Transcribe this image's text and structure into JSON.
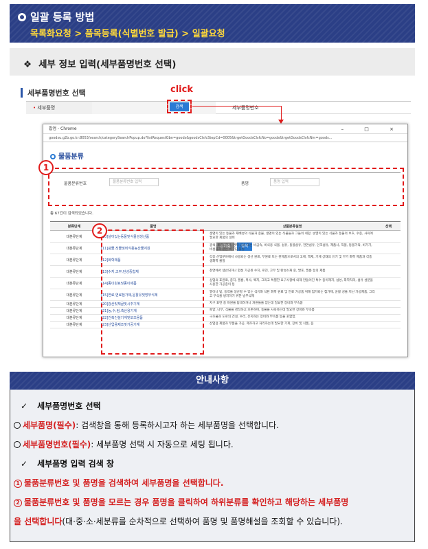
{
  "header": {
    "title": "일괄 등록 방법",
    "subtitle": "목록화요청 > 품목등록(식별번호 발급) > 일괄요청"
  },
  "section": {
    "title": "세부 정보 입력(세부품명번호 선택)"
  },
  "screenshot": {
    "title": "세부품명번호 선택",
    "click_label": "click",
    "row_label": "세부품명",
    "search_btn": "검색",
    "row_label2": "세부품명번호"
  },
  "popup": {
    "window_title": "팝업 - Chrome",
    "window_controls": "– □ ×",
    "url": "goodsu.g2b.go.kr:8053/search/categorySearchPopup.do?listRequestGbn=goods&goodsClsfcStepCd=0005&trgetGoodsClsfcNo=goods&trgetGoodsClsfcNm=goods...",
    "heading": "물품분류",
    "marker1": "1",
    "marker2": "2",
    "field1_label": "물품분류번호",
    "field1_placeholder": "물품분류번호 입력",
    "field2_label": "품명",
    "field2_placeholder": "품명 입력",
    "reset_btn": "초기화",
    "search_btn": "검색",
    "total": "총 67건이 검색되었습니다.",
    "columns": [
      "분류단계",
      "품명",
      "상품분류설명",
      "선택"
    ],
    "rows": [
      {
        "stage": "대분류단계",
        "name": "[10]살아있는동물및식물성생산품",
        "desc": "생명이 있는 동물과 재배성의 식물과 종물, 생명이 있는 식물들과 그들의 세망, 씻멸이 있는 식물과 동물의 보호, 수종, 사육에 필요한 제품의 설비"
      },
      {
        "stage": "대분류단계",
        "name": "[11]광물,직물및비식용농산물지원",
        "desc": "광석, 토양, 광석, 경제 금속 또는 비금속, 비식용 식물, 섬유, 동물섬유, 천연섬유, 인조섬유, 제품사, 직물, 동물가죽, 비가기, 비섬물과 같은 비 가공물질"
      },
      {
        "stage": "대분류단계",
        "name": "[12]화학제품",
        "desc": "각종 산업분야에서 사용되는 생산 원료, 부원료 또는 완제품으로서의 고체, 액체, 기체 상태의 유기 및 무기 화학 제품과 각종 생화학 물질"
      },
      {
        "stage": "대분류단계",
        "name": "[13]수지,고무,탄성중합체",
        "desc": "천연에서 생산되거나 합성 가공된 수지, 로진, 고무 및 탄성소재 중, 발포, 필름 등의 제품"
      },
      {
        "stage": "대분류단계",
        "name": "[14]종이원료및종이제품",
        "desc": "상업의 표원료, 종지, 필름, 목사, 백지, 그리고 특별한 요구사항에 의해 만들어진 특수 종이제지, 섬성, 화학처리, 섬유 성분을 사용한 가공종이 등"
      },
      {
        "stage": "대분류단계",
        "name": "[15]연료,연료첨가제,윤활유및방부식제",
        "desc": "열이나 빛, 동력을 생산할 수 있는 석유와 석탄 화학 원료 및 연료 가공품 위해 첨가되는 첨가제, 윤활 성을 지닌 가공제품, 그리고 부식을 방지하기 위한 방부식제"
      },
      {
        "stage": "대분류단계",
        "name": "[20]광산및채굴및시추기계",
        "desc": "지구 표면 중 자원을 탐색하거나 자원들을 얻는데 필요한 장비와 부속품"
      },
      {
        "stage": "대분류단계",
        "name": "[21]농,수,림,축산용기계",
        "desc": "토양, 나무, 식물을 경작하고 보존하며, 동물을 사육하는데 필요한 장비와 부속품"
      },
      {
        "stage": "대분류단계",
        "name": "[22]건축건설기계및보조용품",
        "desc": "구조물과 도로의 건설, 수리, 유지하는 장비와 부속품 등을 포함함."
      },
      {
        "stage": "대분류단계",
        "name": "[23]산업용제조및가공기계",
        "desc": "산업용 제품과 부품을 가공, 제조하고 처리하는데 필요한 기계, 장비 및 식품, 음"
      }
    ]
  },
  "guide": {
    "title": "안내사항",
    "h1": "세부품명번호 선택",
    "l1_bold": "세부품명(필수)",
    "l1_text": ": 검색창을 통해 등록하시고자 하는 세부품명을 선택합니다.",
    "l2_bold": "세부품명번호(필수)",
    "l2_text": ":  세부품명 선택 시 자동으로 세팅 됩니다.",
    "h2": "세부품명 입력 검색 창",
    "s1": "물품분류번호 및 품명을 검색하여 세부품명을 선택합니다.",
    "s2a": "물품분류번호 및 품명을 모르는 경우 품명을 클릭하여 하위분류를 확인하고 해당하는 세부품명",
    "s2b_red": "을 선택합니다",
    "s2b_text": "(대·중·소·세분류를 순차적으로 선택하여 품명 및 품명해설을 조회할 수 있습니다).",
    "check": "✓",
    "n1": "1",
    "n2": "2"
  }
}
